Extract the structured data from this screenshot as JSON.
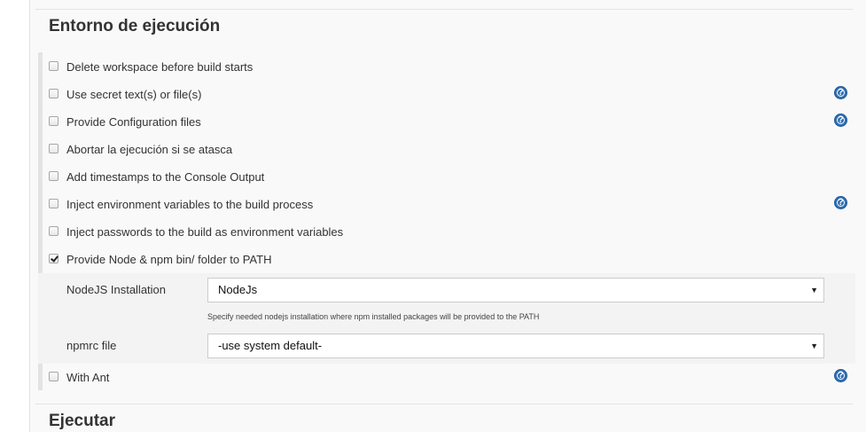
{
  "section_title": "Entorno de ejecución",
  "next_section_title": "Ejecutar",
  "options": [
    {
      "label": "Delete workspace before build starts",
      "checked": false,
      "help": false
    },
    {
      "label": "Use secret text(s) or file(s)",
      "checked": false,
      "help": true
    },
    {
      "label": "Provide Configuration files",
      "checked": false,
      "help": true
    },
    {
      "label": "Abortar la ejecución si se atasca",
      "checked": false,
      "help": false
    },
    {
      "label": "Add timestamps to the Console Output",
      "checked": false,
      "help": false
    },
    {
      "label": "Inject environment variables to the build process",
      "checked": false,
      "help": true
    },
    {
      "label": "Inject passwords to the build as environment variables",
      "checked": false,
      "help": false
    },
    {
      "label": "Provide Node & npm bin/ folder to PATH",
      "checked": true,
      "help": false
    },
    {
      "label": "With Ant",
      "checked": false,
      "help": true
    }
  ],
  "nodejs": {
    "installation_label": "NodeJS Installation",
    "installation_value": "NodeJs",
    "installation_hint": "Specify needed nodejs installation where npm installed packages will be provided to the PATH",
    "npmrc_label": "npmrc file",
    "npmrc_value": "-use system default-"
  },
  "help_glyph": "?",
  "select_arrow_glyph": "▼",
  "icons": {
    "help": "help-circle-icon",
    "dropdown": "chevron-down-icon",
    "checkbox": "checkbox"
  },
  "colors": {
    "help_icon": "#2f6fb3",
    "panel_bg": "#f9f9f9",
    "sub_panel_bg": "#f3f3f3"
  }
}
